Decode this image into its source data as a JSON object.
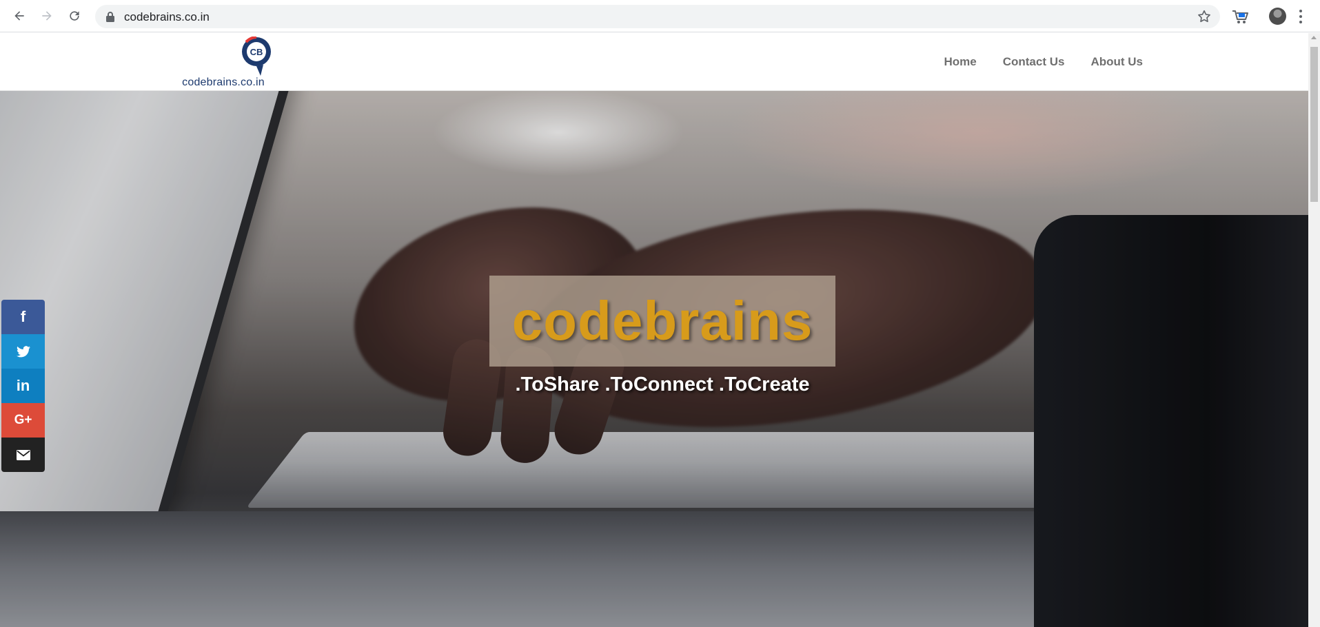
{
  "browser": {
    "url": "codebrains.co.in",
    "icons": {
      "back": "back-arrow-icon",
      "forward": "forward-arrow-icon",
      "reload": "reload-icon",
      "lock": "lock-icon",
      "bookmark": "star-icon",
      "extension": "cart-extension-icon",
      "profile": "avatar",
      "menu": "kebab-menu-icon"
    }
  },
  "site": {
    "logo_text": "codebrains.co.in",
    "logo_mark": "CB",
    "nav": {
      "home": "Home",
      "contact": "Contact Us",
      "about": "About Us"
    },
    "hero": {
      "title": "codebrains",
      "tagline": ".ToShare .ToConnect .ToCreate"
    },
    "social": {
      "facebook": "f",
      "twitter": "twitter-icon",
      "linkedin": "in",
      "googleplus": "G+",
      "email": "email-icon"
    }
  },
  "colors": {
    "title": "#d79b1b",
    "nav_text": "#6f6f6f",
    "facebook": "#3b5998",
    "twitter": "#1a91d0",
    "linkedin": "#0e7fc0",
    "googleplus": "#dd4b39",
    "email": "#222222",
    "logo": "#1d3a6e"
  }
}
